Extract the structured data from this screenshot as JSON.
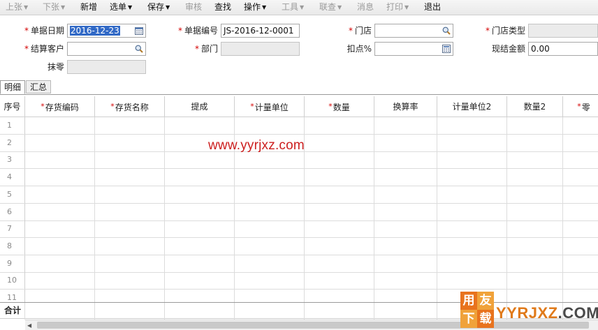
{
  "toolbar": {
    "items": [
      {
        "label": "上张",
        "arrow": true,
        "enabled": false
      },
      {
        "label": "下张",
        "arrow": true,
        "enabled": false
      },
      {
        "label": "新增",
        "arrow": false,
        "enabled": true
      },
      {
        "label": "选单",
        "arrow": true,
        "enabled": true
      },
      {
        "label": "保存",
        "arrow": true,
        "enabled": true
      },
      {
        "label": "审核",
        "arrow": false,
        "enabled": false
      },
      {
        "label": "查找",
        "arrow": false,
        "enabled": true
      },
      {
        "label": "操作",
        "arrow": true,
        "enabled": true
      },
      {
        "label": "工具",
        "arrow": true,
        "enabled": false
      },
      {
        "label": "联查",
        "arrow": true,
        "enabled": false
      },
      {
        "label": "消息",
        "arrow": false,
        "enabled": false
      },
      {
        "label": "打印",
        "arrow": true,
        "enabled": false
      },
      {
        "label": "退出",
        "arrow": false,
        "enabled": true
      }
    ],
    "arrow_glyph": "▼"
  },
  "form": {
    "doc_date": {
      "label": "单据日期",
      "value": "2016-12-23",
      "required": true
    },
    "doc_no": {
      "label": "单据编号",
      "value": "JS-2016-12-0001",
      "required": true
    },
    "store": {
      "label": "门店",
      "value": "",
      "required": true
    },
    "store_type": {
      "label": "门店类型",
      "value": "",
      "required": true
    },
    "customer": {
      "label": "结算客户",
      "value": "",
      "required": true
    },
    "dept": {
      "label": "部门",
      "value": "",
      "required": true
    },
    "discount": {
      "label": "扣点%",
      "value": ""
    },
    "cash_amount": {
      "label": "现结金额",
      "value": "0.00"
    },
    "rounding": {
      "label": "抹零",
      "value": ""
    },
    "required_mark": "*"
  },
  "tabs": [
    {
      "label": "明细",
      "active": true
    },
    {
      "label": "汇总",
      "active": false
    }
  ],
  "grid": {
    "columns": [
      {
        "label": "序号",
        "required": false
      },
      {
        "label": "存货编码",
        "required": true
      },
      {
        "label": "存货名称",
        "required": true
      },
      {
        "label": "提成",
        "required": false
      },
      {
        "label": "计量单位",
        "required": true
      },
      {
        "label": "数量",
        "required": true
      },
      {
        "label": "换算率",
        "required": false
      },
      {
        "label": "计量单位2",
        "required": false
      },
      {
        "label": "数量2",
        "required": false
      },
      {
        "label": "零",
        "required": true
      }
    ],
    "row_numbers": [
      "1",
      "2",
      "3",
      "4",
      "5",
      "6",
      "7",
      "8",
      "9",
      "10",
      "11"
    ],
    "footer_label": "合计"
  },
  "watermark": {
    "url_text": "www.yyrjxz.com",
    "logo_chars": [
      "用",
      "友",
      "下",
      "载"
    ],
    "logo_text_a": "YYRJXZ",
    "logo_text_b": ".COM",
    "logo_colors": [
      "#e8731e",
      "#f0a23a",
      "#f0a23a",
      "#e8731e"
    ]
  },
  "colors": {
    "selection": "#3169c6",
    "required": "#d40000",
    "watermark_url": "#cc1f1f"
  }
}
